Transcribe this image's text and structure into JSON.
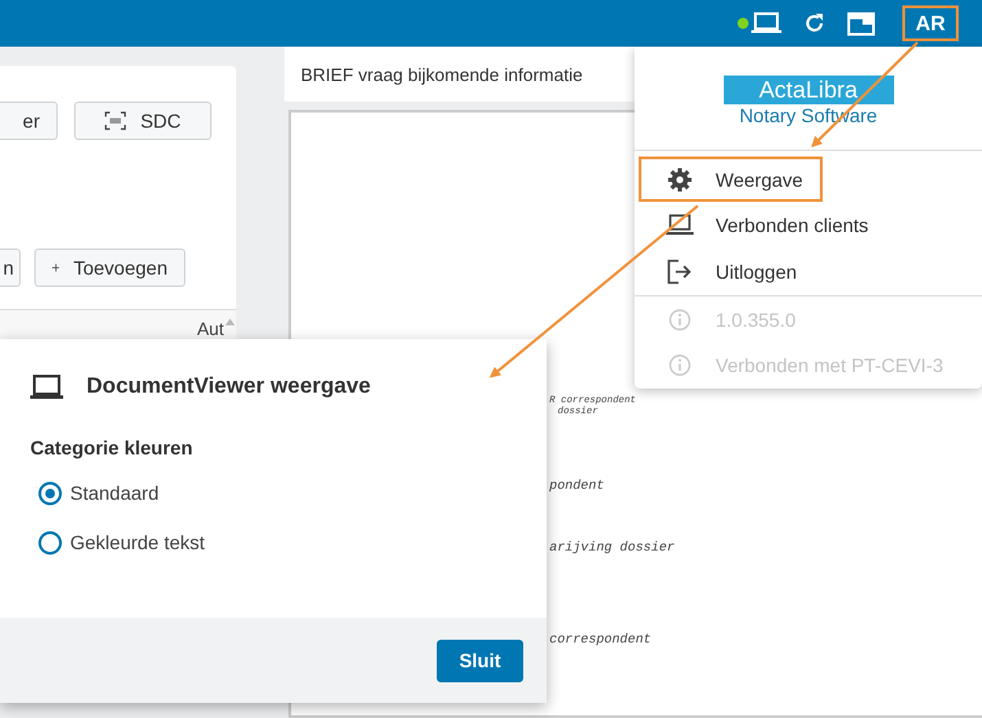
{
  "top_bar": {
    "online": true,
    "user_initials": "AR",
    "user_highlighted": true
  },
  "left_panel": {
    "buttons": [
      {
        "label": "er",
        "kind": "plain"
      },
      {
        "label": "SDC",
        "kind": "sdc"
      },
      {
        "label": "n",
        "kind": "plain"
      },
      {
        "label": "Toevoegen",
        "kind": "add"
      }
    ],
    "column_1": "Aut"
  },
  "document": {
    "title": "BRIEF vraag bijkomende informatie",
    "fragments": [
      {
        "text": "R correspondent",
        "kind": "small"
      },
      {
        "text": "dossier",
        "kind": "small"
      },
      {
        "text": "pondent",
        "kind": "normal"
      },
      {
        "text": "arijving dossier",
        "kind": "normal"
      },
      {
        "text": "correspondent",
        "kind": "normal"
      }
    ]
  },
  "user_menu": {
    "logo_top": "ActaLibra",
    "logo_bottom": "Notary Software",
    "items": [
      {
        "label": "Weergave",
        "kind": "gear",
        "disabled": false,
        "highlighted": true
      },
      {
        "label": "Verbonden clients",
        "kind": "laptop",
        "disabled": false,
        "highlighted": false
      },
      {
        "label": "Uitloggen",
        "kind": "logout",
        "disabled": false,
        "highlighted": false
      },
      {
        "label": "1.0.355.0",
        "kind": "info",
        "disabled": true,
        "highlighted": false
      },
      {
        "label": "Verbonden met PT-CEVI-3",
        "kind": "info",
        "disabled": true,
        "highlighted": false
      }
    ]
  },
  "dialog": {
    "title": "DocumentViewer weergave",
    "section": "Categorie kleuren",
    "options": [
      {
        "label": "Standaard",
        "selected": true
      },
      {
        "label": "Gekleurde tekst",
        "selected": false
      }
    ],
    "button": "Sluit"
  }
}
